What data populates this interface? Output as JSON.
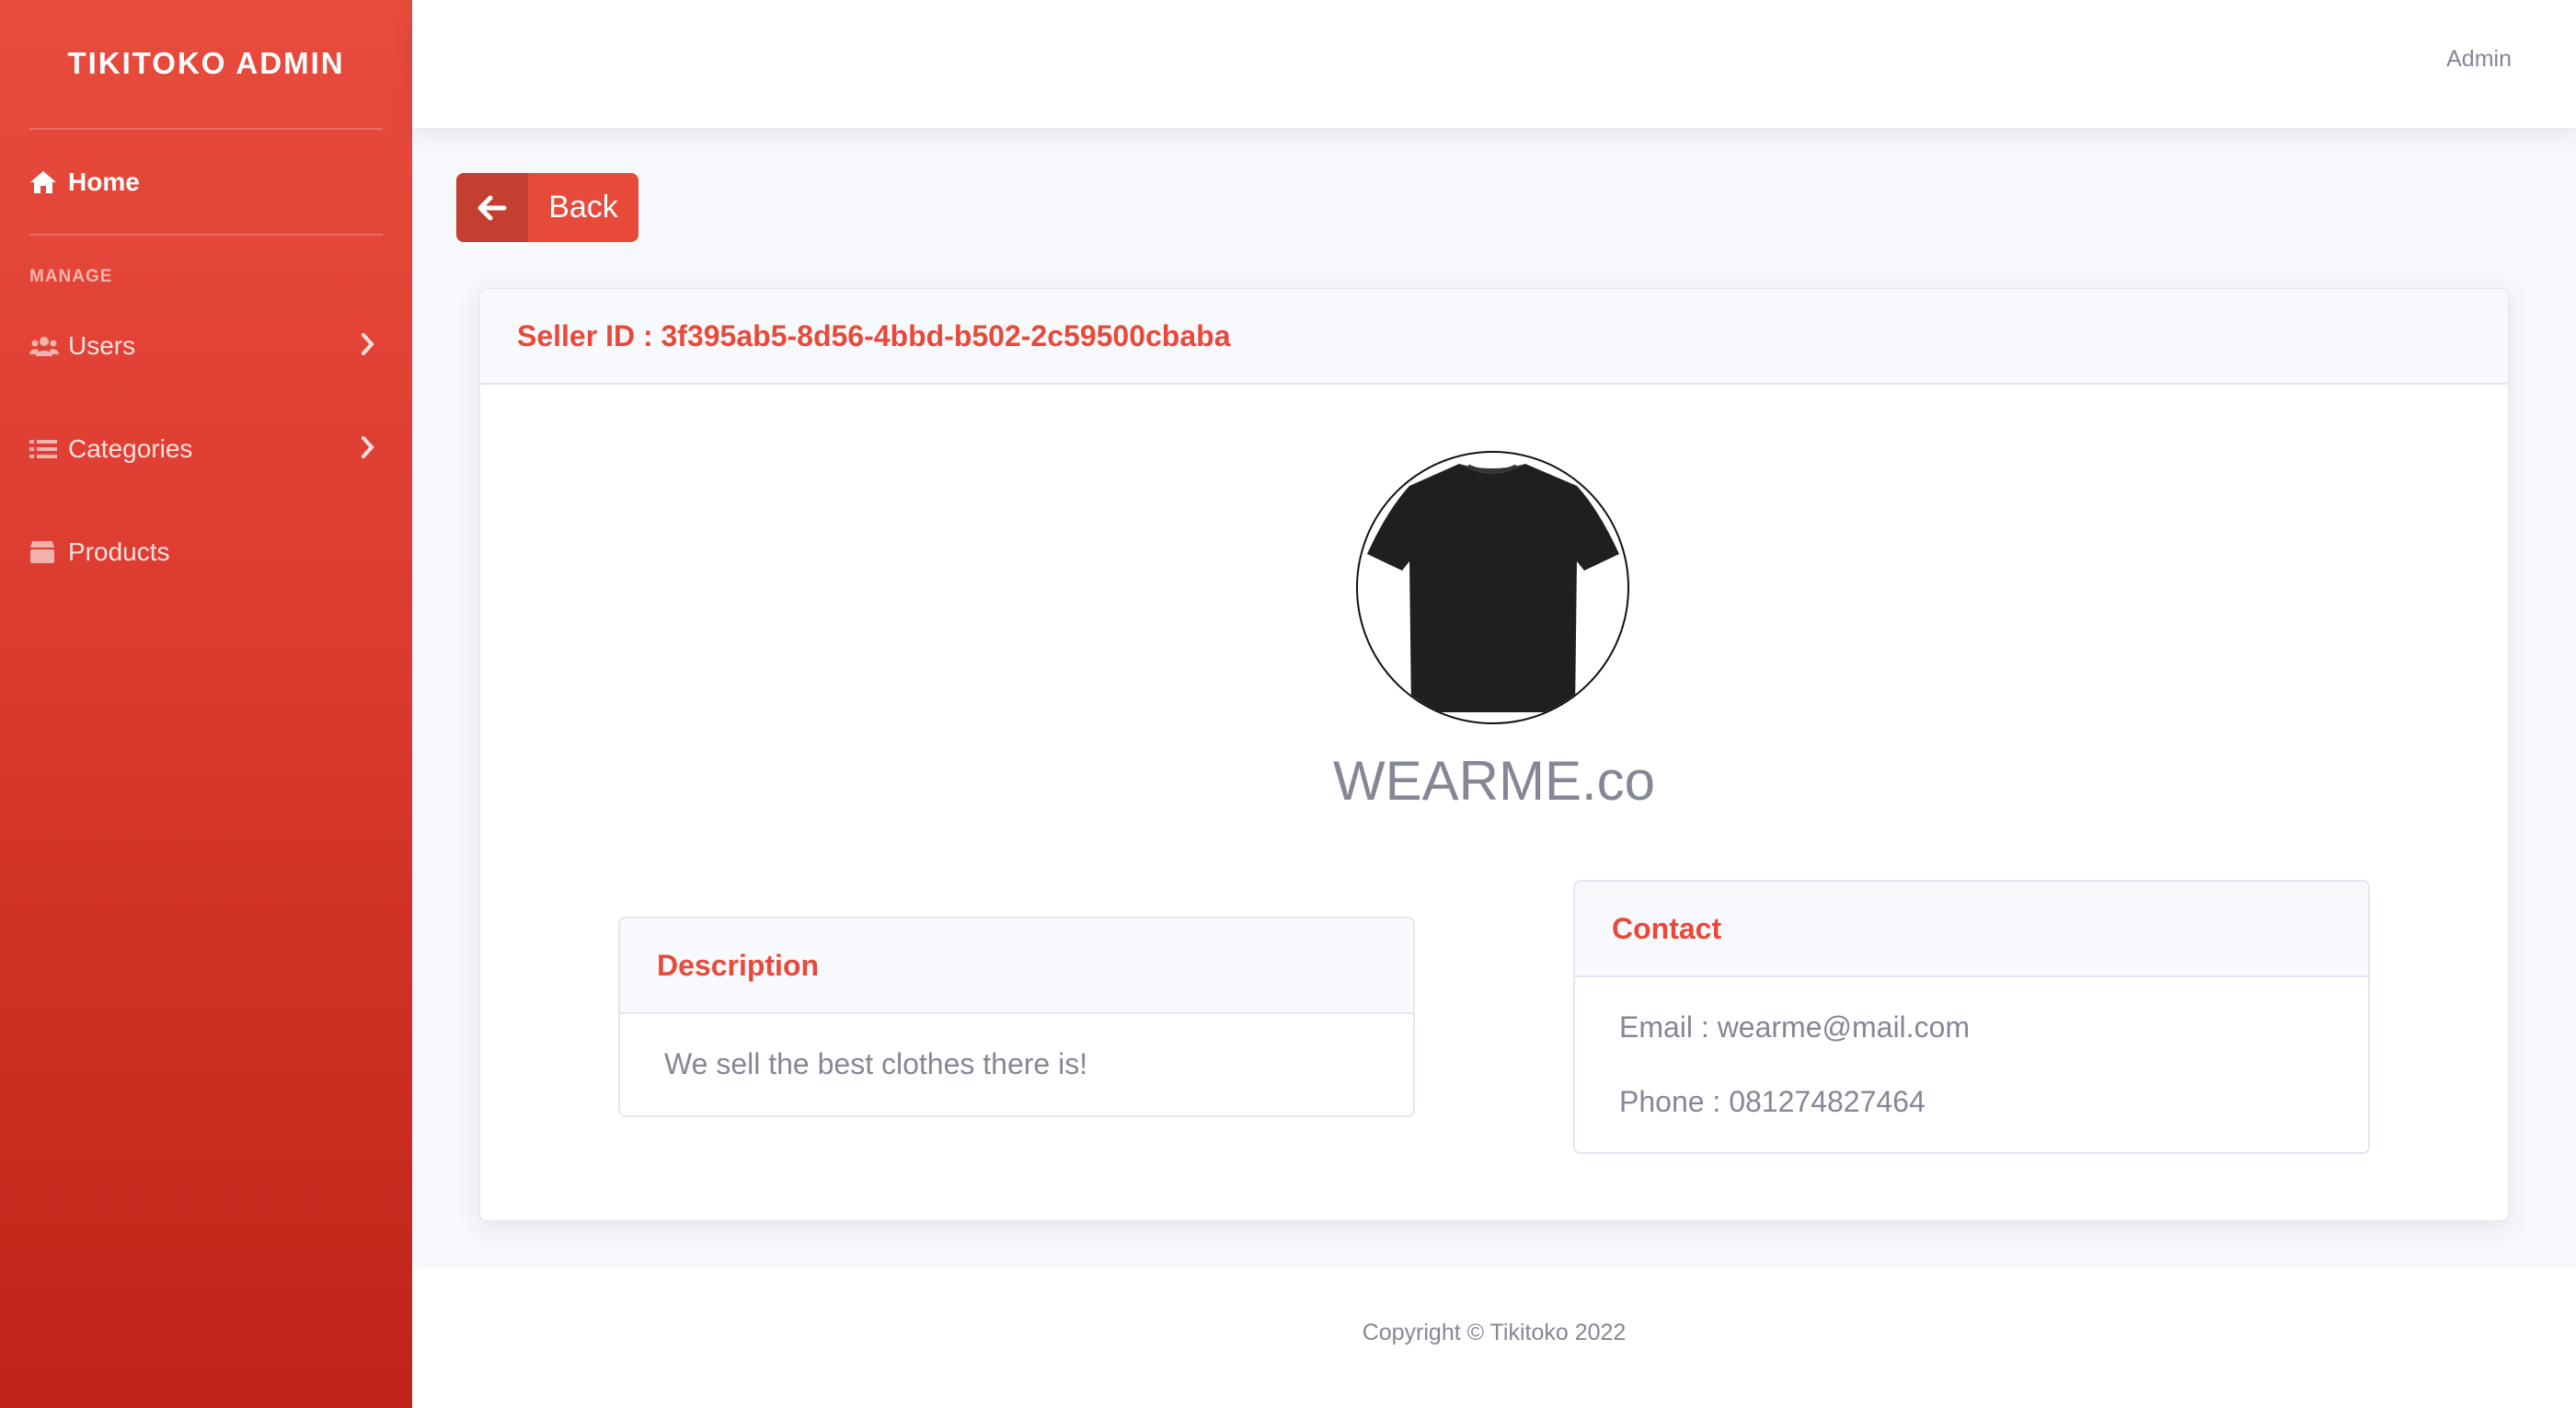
{
  "sidebar": {
    "brand": "TIKITOKO ADMIN",
    "home_label": "Home",
    "manage_heading": "MANAGE",
    "items": [
      {
        "label": "Users",
        "icon": "users-icon"
      },
      {
        "label": "Categories",
        "icon": "list-icon"
      },
      {
        "label": "Products",
        "icon": "box-icon"
      }
    ]
  },
  "topbar": {
    "user": "Admin"
  },
  "back_button": {
    "label": "Back",
    "icon": "arrow-left-icon"
  },
  "seller": {
    "id_label": "Seller ID : 3f395ab5-8d56-4bbd-b502-2c59500cbaba",
    "store_name": "WEARME.co",
    "avatar": "black-tshirt-image",
    "description_title": "Description",
    "description": "We sell the best clothes there is!",
    "contact_title": "Contact",
    "email": "Email : wearme@mail.com",
    "phone": "Phone : 081274827464"
  },
  "footer": {
    "copyright": "Copyright © Tikitoko 2022"
  },
  "colors": {
    "brand_red": "#e74a3b",
    "text_gray": "#858796"
  }
}
